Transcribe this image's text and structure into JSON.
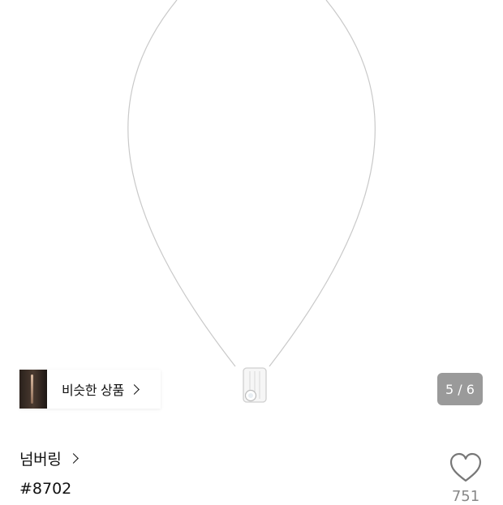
{
  "gallery": {
    "counter": "5 / 6"
  },
  "similar": {
    "label": "비슷한 상품"
  },
  "product": {
    "brand": "넘버링",
    "code": "#8702",
    "likes": "751"
  },
  "icons": {
    "like": "heart-outline-icon",
    "similar_arrow": "chevron-right-icon",
    "brand_arrow": "chevron-right-icon"
  },
  "colors": {
    "text": "#111111",
    "muted": "#888888",
    "counter_bg": "#787878"
  }
}
